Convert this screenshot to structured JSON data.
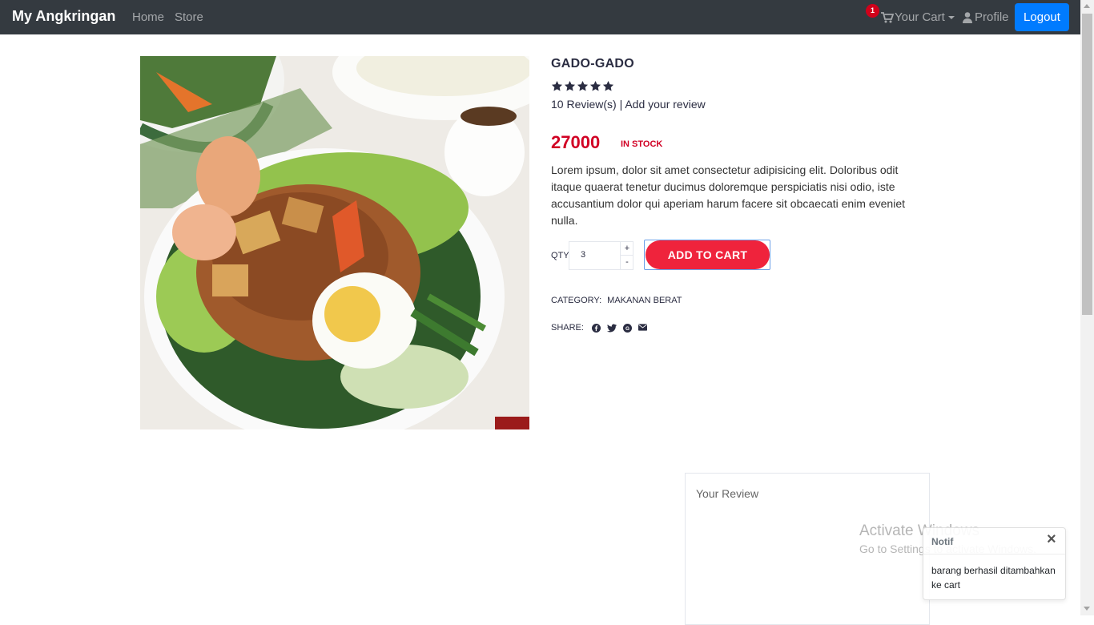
{
  "navbar": {
    "brand": "My Angkringan",
    "home": "Home",
    "store": "Store",
    "cart_count": "1",
    "cart_label": "Your Cart",
    "profile_label": "Profile",
    "logout_label": "Logout"
  },
  "product": {
    "image_icon": "gado-gado-photo",
    "title": "GADO-GADO",
    "rating": 5,
    "reviews_text": "10 Review(s) | Add your review",
    "price": "27000",
    "stock": "IN STOCK",
    "description": "Lorem ipsum, dolor sit amet consectetur adipisicing elit. Doloribus odit itaque quaerat tenetur ducimus doloremque perspiciatis nisi odio, iste accusantium dolor qui aperiam harum facere sit obcaecati enim eveniet nulla.",
    "qty_label": "QTY",
    "qty_value": "3",
    "qty_plus": "+",
    "qty_minus": "-",
    "add_to_cart": "ADD TO CART",
    "category_label": "CATEGORY:",
    "category_value": "MAKANAN BERAT",
    "share_label": "SHARE:",
    "share_icons": [
      "facebook-icon",
      "twitter-icon",
      "google-plus-icon",
      "envelope-icon"
    ]
  },
  "review": {
    "title": "Your Review"
  },
  "watermark": {
    "title": "Activate Windows",
    "subtitle": "Go to Settings to activate Windows."
  },
  "toast": {
    "title": "Notif",
    "close": "×",
    "body": "barang berhasil ditambahkan ke cart"
  },
  "colors": {
    "navbar_bg": "#343a40",
    "accent": "#d10024",
    "button": "#ef233c",
    "logout": "#007bff"
  }
}
